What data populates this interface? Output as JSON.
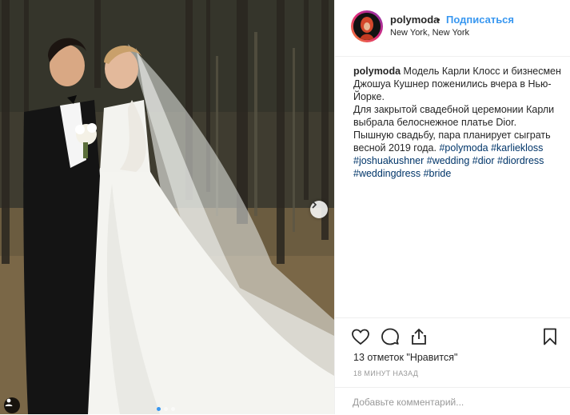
{
  "colors": {
    "accent": "#3897f0",
    "hashtag": "#003569",
    "muted": "#999999",
    "text": "#262626"
  },
  "post": {
    "username": "polymoda",
    "separator": "•",
    "follow_label": "Подписаться",
    "location": "New York, New York",
    "photo_count": 3,
    "active_photo": 1
  },
  "caption": {
    "author": "polymoda",
    "lines": [
      "Модель Карли Клосс и бизнесмен Джошуа Кушнер поженились вчера в Нью-Йорке.",
      "Для закрытой свадебной церемонии Карли выбрала белоснежное платье Dior.",
      "Пышную свадьбу, пара планирует сыграть весной 2019 года."
    ],
    "hashtags": [
      "#polymoda",
      "#karliekloss",
      "#joshuakushner",
      "#wedding",
      "#dior",
      "#diordress",
      "#weddingdress",
      "#bride"
    ]
  },
  "actions": {
    "icons": [
      "heart-icon",
      "comment-icon",
      "share-icon",
      "bookmark-icon"
    ]
  },
  "likes_text": "13 отметок \"Нравится\"",
  "time_ago": "18 МИНУТ НАЗАД",
  "comment": {
    "placeholder": "Добавьте комментарий...",
    "value": ""
  }
}
